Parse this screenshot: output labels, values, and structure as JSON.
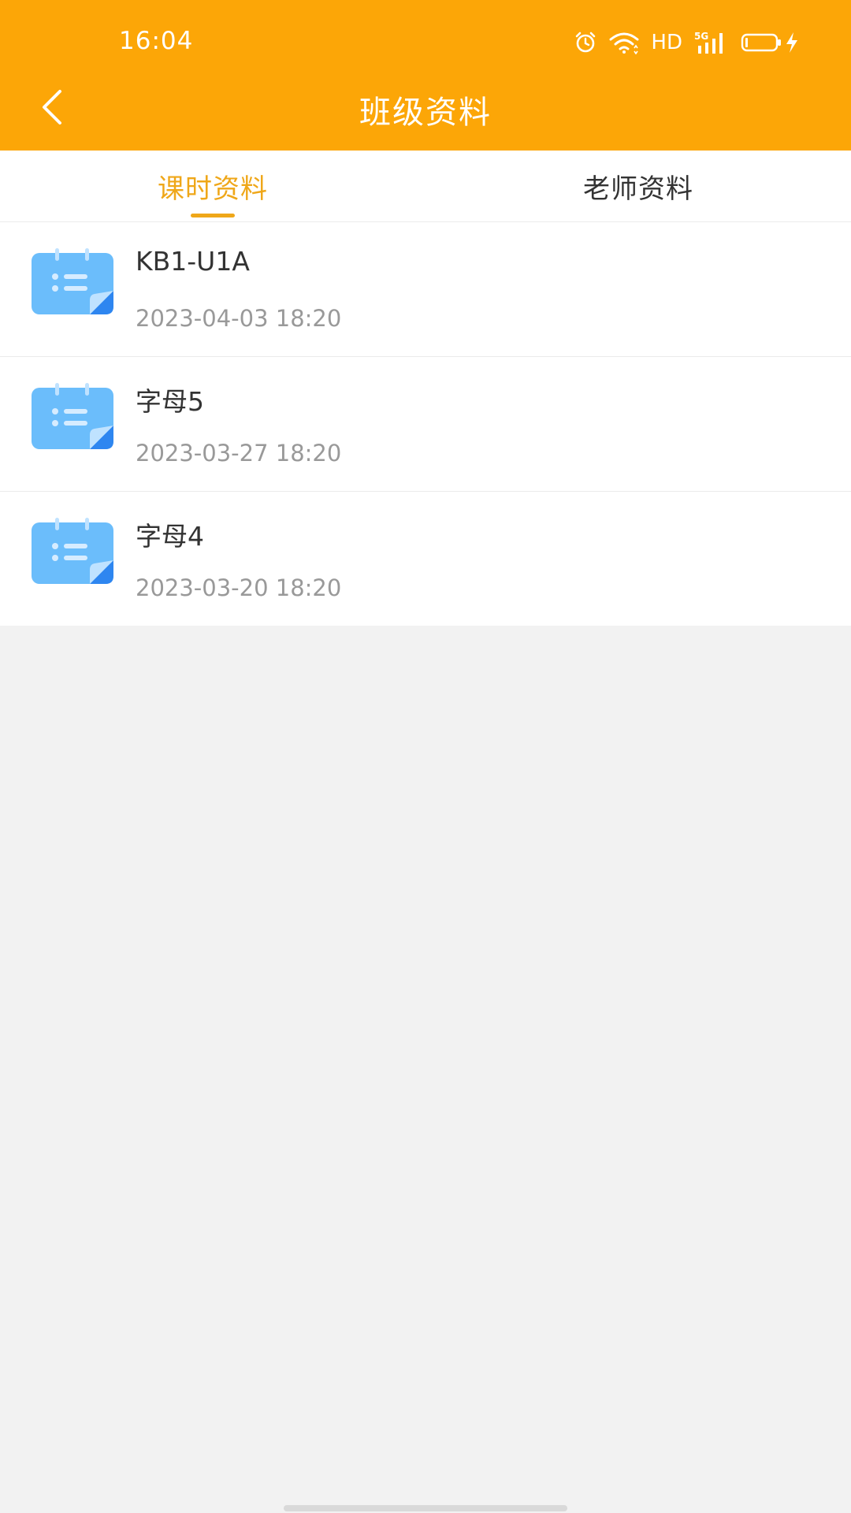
{
  "status_bar": {
    "time": "16:04",
    "network_badge": "5G",
    "hd_label": "HD",
    "icons": [
      "alarm-icon",
      "wifi-icon",
      "signal-icon",
      "battery-icon",
      "charging-icon"
    ]
  },
  "header": {
    "title": "班级资料",
    "back_icon": "chevron-left-icon"
  },
  "tabs": [
    {
      "label": "课时资料",
      "active": true
    },
    {
      "label": "老师资料",
      "active": false
    }
  ],
  "items": [
    {
      "title": "KB1-U1A",
      "date": "2023-04-03 18:20",
      "icon": "calendar-icon"
    },
    {
      "title": "字母5",
      "date": "2023-03-27 18:20",
      "icon": "calendar-icon"
    },
    {
      "title": "字母4",
      "date": "2023-03-20 18:20",
      "icon": "calendar-icon"
    }
  ],
  "colors": {
    "header_bg": "#FCA607",
    "tab_active": "#EFA719",
    "icon_blue": "#6BBDFB",
    "page_bg": "#F2F2F2"
  }
}
